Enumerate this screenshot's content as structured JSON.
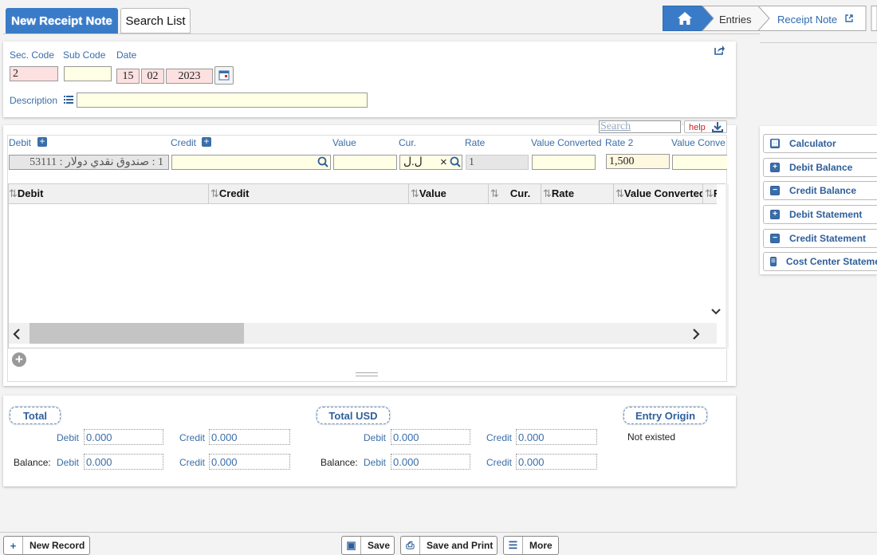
{
  "tabs": {
    "new_receipt": "New Receipt Note",
    "search_list": "Search List"
  },
  "breadcrumb": {
    "entries": "Entries",
    "current": "Receipt Note"
  },
  "header_form": {
    "sec_code_label": "Sec. Code",
    "sub_code_label": "Sub Code",
    "date_label": "Date",
    "sec_code_value": "2",
    "sub_code_value": "",
    "date_day": "15",
    "date_month": "02",
    "date_year": "2023",
    "description_label": "Description",
    "description_value": ""
  },
  "entry_form": {
    "search_placeholder": "Search",
    "help_label": "help",
    "debit_label": "Debit",
    "credit_label": "Credit",
    "value_label": "Value",
    "cur_label": "Cur.",
    "rate_label": "Rate",
    "value_converted_label": "Value Converted",
    "rate2_label": "Rate 2",
    "value_conve_label": "Value Conve",
    "debit_value": "1 : صندوق نقدي دولار : 53111",
    "cur_value": "ل.ل",
    "rate_value": "1",
    "rate2_value": "1,500"
  },
  "grid": {
    "columns": [
      "Debit",
      "Credit",
      "Value",
      "Cur.",
      "Rate",
      "Value Converted",
      "R"
    ]
  },
  "totals": {
    "total_legend": "Total",
    "total_usd_legend": "Total USD",
    "entry_origin_legend": "Entry Origin",
    "debit_label": "Debit",
    "credit_label": "Credit",
    "balance_label": "Balance:",
    "total_debit": "0.000",
    "total_credit": "0.000",
    "balance_debit": "0.000",
    "balance_credit": "0.000",
    "usd_debit": "0.000",
    "usd_credit": "0.000",
    "usd_balance_debit": "0.000",
    "usd_balance_credit": "0.000",
    "entry_origin_value": "Not existed"
  },
  "side_panel": {
    "calculator": "Calculator",
    "debit_balance": "Debit Balance",
    "credit_balance": "Credit Balance",
    "debit_statement": "Debit Statement",
    "credit_statement": "Credit Statement",
    "cost_center": "Cost Center Statement"
  },
  "bottom_bar": {
    "new_record": "New Record",
    "save": "Save",
    "save_print": "Save and Print",
    "more": "More"
  }
}
